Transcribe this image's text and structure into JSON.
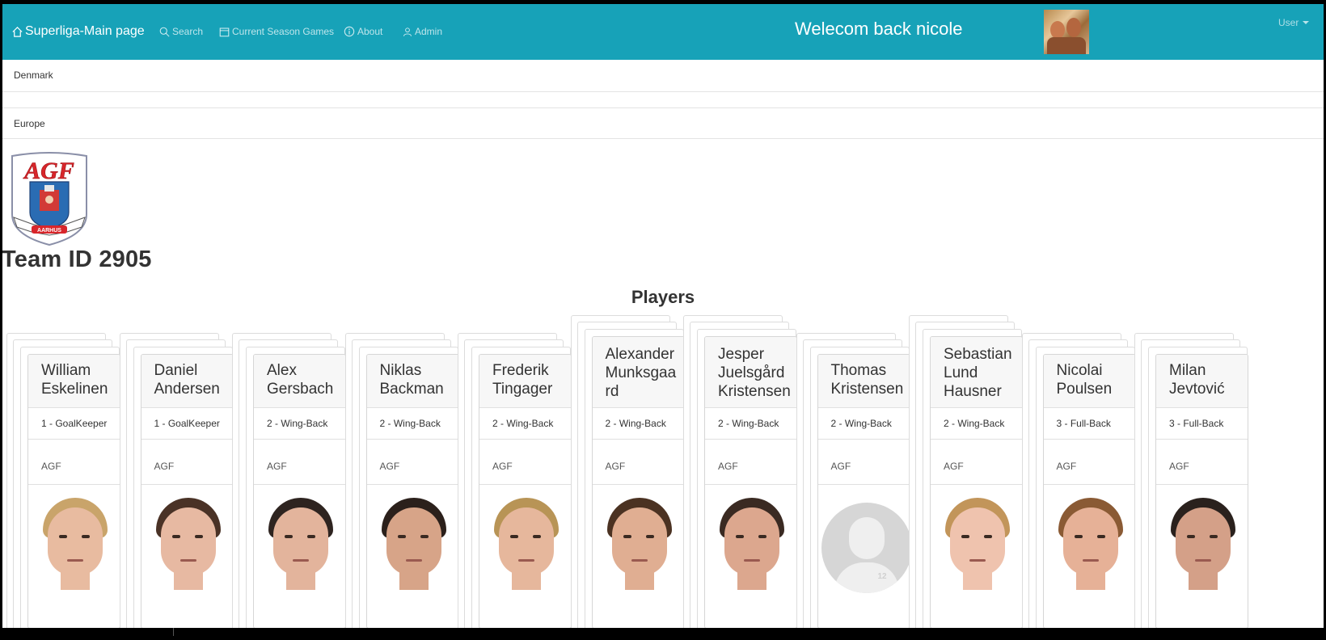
{
  "navbar": {
    "brand": "Superliga-Main page",
    "links": [
      {
        "label": "Search",
        "icon": "search-icon"
      },
      {
        "label": "Current Season Games",
        "icon": "calendar-icon"
      },
      {
        "label": "About",
        "icon": "info-icon"
      },
      {
        "label": "Admin",
        "icon": "person-icon"
      }
    ],
    "welcome": "Welecom back nicole",
    "user_menu": "User",
    "color": "#17a2b8"
  },
  "regions": [
    "Denmark",
    "",
    "Europe"
  ],
  "team": {
    "logo_text": "AGF",
    "logo_subtext": "AARHUS",
    "heading": "Team ID 2905"
  },
  "players_heading": "Players",
  "players": [
    {
      "name": "William\nEskelinen",
      "position": "1 - GoalKeeper",
      "team": "AGF",
      "photo": "face",
      "hair": "#c9a46a",
      "skin": "#e8bba0"
    },
    {
      "name": "Daniel\nAndersen",
      "position": "1 - GoalKeeper",
      "team": "AGF",
      "photo": "face",
      "hair": "#4a3226",
      "skin": "#e7b9a2"
    },
    {
      "name": "Alex\nGersbach",
      "position": "2 - Wing-Back",
      "team": "AGF",
      "photo": "face",
      "hair": "#2e2420",
      "skin": "#e3b49c"
    },
    {
      "name": "Niklas\nBackman",
      "position": "2 - Wing-Back",
      "team": "AGF",
      "photo": "face",
      "hair": "#2b201b",
      "skin": "#d7a488"
    },
    {
      "name": "Frederik\nTingager",
      "position": "2 - Wing-Back",
      "team": "AGF",
      "photo": "face",
      "hair": "#b89456",
      "skin": "#e6b79c"
    },
    {
      "name": "Alexander\nMunksgaa\nrd",
      "position": "2 - Wing-Back",
      "team": "AGF",
      "photo": "face",
      "hair": "#4b3222",
      "skin": "#e0ae92"
    },
    {
      "name": "Jesper\nJuelsgård\nKristensen",
      "position": "2 - Wing-Back",
      "team": "AGF",
      "photo": "face",
      "hair": "#3a2a22",
      "skin": "#dca78e"
    },
    {
      "name": "Thomas\nKristensen",
      "position": "2 - Wing-Back",
      "team": "AGF",
      "photo": "placeholder",
      "placeholder_number": "12"
    },
    {
      "name": "Sebastian\nLund\nHausner",
      "position": "2 - Wing-Back",
      "team": "AGF",
      "photo": "face",
      "hair": "#c2955a",
      "skin": "#efc3ae"
    },
    {
      "name": "Nicolai\nPoulsen",
      "position": "3 - Full-Back",
      "team": "AGF",
      "photo": "face",
      "hair": "#8a5a34",
      "skin": "#e6b197"
    },
    {
      "name": "Milan\nJevtović",
      "position": "3 - Full-Back",
      "team": "AGF",
      "photo": "face",
      "hair": "#2a211d",
      "skin": "#d4a088"
    }
  ]
}
